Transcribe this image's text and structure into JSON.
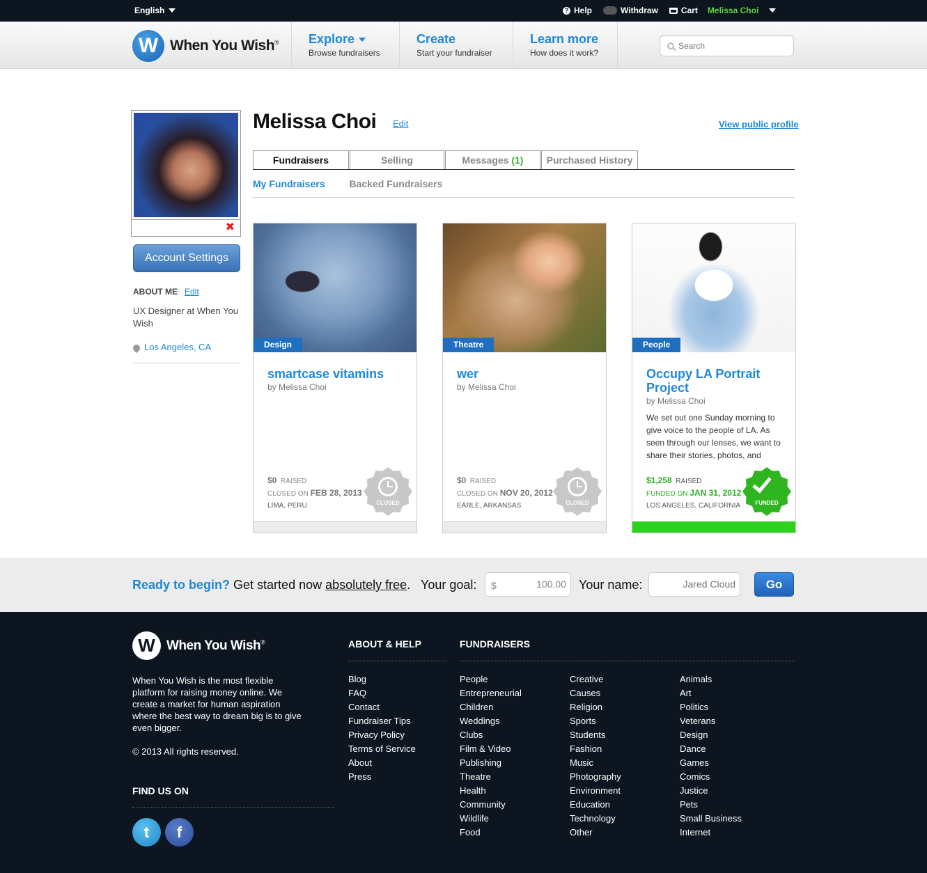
{
  "topbar": {
    "language": "English",
    "help": "Help",
    "withdraw": "Withdraw",
    "cart": "Cart",
    "user": "Melissa Choi"
  },
  "header": {
    "logo_text": "When You Wish",
    "logo_mark": "W",
    "logo_reg": "®",
    "nav": [
      {
        "title": "Explore",
        "sub": "Browse fundraisers"
      },
      {
        "title": "Create",
        "sub": "Start your fundraiser"
      },
      {
        "title": "Learn more",
        "sub": "How does it work?"
      }
    ],
    "search_placeholder": "Search"
  },
  "sidebar": {
    "delete_icon": "✖",
    "account_settings": "Account Settings",
    "about_me_label": "ABOUT ME",
    "edit_label": "Edit",
    "about_text": "UX Designer at When You Wish",
    "location": "Los Angeles, CA"
  },
  "profile": {
    "name": "Melissa Choi",
    "edit_label": "Edit",
    "view_public": "View public profile",
    "tabs": [
      {
        "label": "Fundraisers",
        "count": ""
      },
      {
        "label": "Selling",
        "count": ""
      },
      {
        "label": "Messages",
        "count": "(1)"
      },
      {
        "label": "Purchased History",
        "count": ""
      }
    ],
    "subtabs": [
      "My Fundraisers",
      "Backed Fundraisers"
    ]
  },
  "cards": [
    {
      "category": "Design",
      "title": "smartcase vitamins",
      "by": "by Melissa Choi",
      "description": "",
      "amount": "$0",
      "raised_label": "RAISED",
      "date_label": "CLOSED ON",
      "date": "FEB 28, 2013",
      "location": "LIMA, PERU",
      "status": "CLOSED"
    },
    {
      "category": "Theatre",
      "title": "wer",
      "by": "by Melissa Choi",
      "description": "",
      "amount": "$0",
      "raised_label": "RAISED",
      "date_label": "CLOSED ON",
      "date": "NOV 20, 2012",
      "location": "EARLE, ARKANSAS",
      "status": "CLOSED"
    },
    {
      "category": "People",
      "title": "Occupy LA Portrait Project",
      "by": "by Melissa Choi",
      "description": "We set out one Sunday morning to give voice to the people of LA. As seen through our lenses, we want to share their stories, photos, and",
      "amount": "$1,258",
      "raised_label": "RAISED",
      "date_label": "FUNDED ON",
      "date": "JAN 31, 2012",
      "location": "LOS ANGELES, CALIFORNIA",
      "status": "FUNDED"
    }
  ],
  "cta": {
    "ready": "Ready to begin?",
    "started": "Get started now",
    "free": "absolutely free",
    "period": ".",
    "goal_label": "Your goal:",
    "currency": "$",
    "goal_value": "100.00",
    "name_label": "Your name:",
    "name_placeholder": "Jared Cloud",
    "go": "Go"
  },
  "footer": {
    "logo_text": "When You Wish",
    "logo_reg": "®",
    "about": "When You Wish is the most flexible platform for raising money online. We create a market for human aspiration where the best way to dream big is to give even bigger.",
    "copyright": "© 2013 All rights reserved.",
    "find_us": "FIND US ON",
    "twitter_glyph": "t",
    "facebook_glyph": "f",
    "about_help_head": "ABOUT & HELP",
    "about_help": [
      "Blog",
      "FAQ",
      "Contact",
      "Fundraiser Tips",
      "Privacy Policy",
      "Terms of Service",
      "About",
      "Press"
    ],
    "fundraisers_head": "FUNDRAISERS",
    "fundraisers_col1": [
      "People",
      "Entrepreneurial",
      "Children",
      "Weddings",
      "Clubs",
      "Film & Video",
      "Publishing",
      "Theatre",
      "Health",
      "Community",
      "Wildlife",
      "Food"
    ],
    "fundraisers_col2": [
      "Creative",
      "Causes",
      "Religion",
      "Sports",
      "Students",
      "Fashion",
      "Music",
      "Photography",
      "Environment",
      "Education",
      "Technology",
      "Other"
    ],
    "fundraisers_col3": [
      "Animals",
      "Art",
      "Politics",
      "Veterans",
      "Design",
      "Dance",
      "Games",
      "Comics",
      "Justice",
      "Pets",
      "Small Business",
      "Internet"
    ]
  }
}
